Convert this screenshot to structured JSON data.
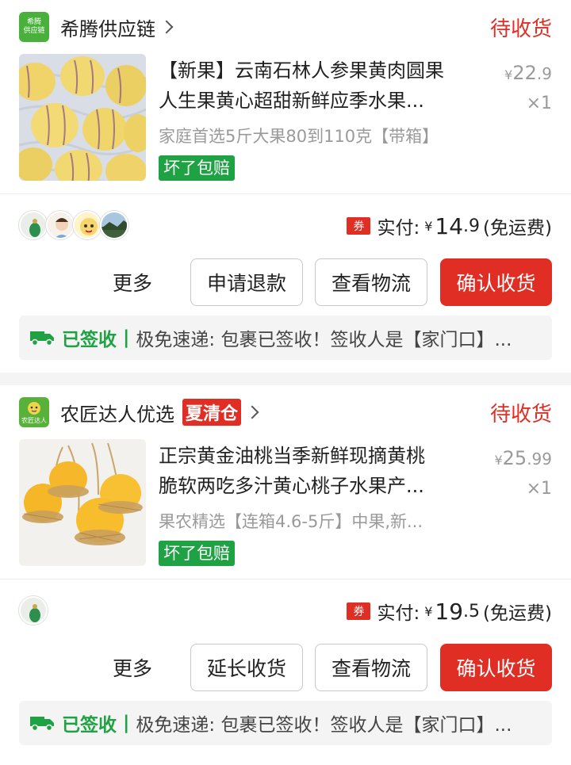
{
  "orders": [
    {
      "shop_logo_lines": [
        "希腾",
        "供应链"
      ],
      "shop_name": "希腾供应链",
      "status": "待收货",
      "title_line1": "【新果】云南石林人参果黄肉圆果",
      "title_line2": "人生果黄心超甜新鲜应季水果...",
      "spec": "家庭首选5斤大果80到110克【带箱】",
      "guarantee": "坏了包赔",
      "price_yen": "¥",
      "price_main": "22",
      "price_dec": ".9",
      "qty": "×1",
      "coupon": "券",
      "paid_label": "实付:",
      "paid_yen": "¥",
      "paid_main": "14",
      "paid_dec": ".9",
      "paid_note": "(免运费)",
      "more_label": "更多",
      "btn1": "申请退款",
      "btn2": "查看物流",
      "btn3": "确认收货",
      "logistics_status": "已签收",
      "logistics_sep": "|",
      "logistics_text": "极免速递: 包裹已签收！签收人是【家门口】..."
    },
    {
      "shop_logo_lines": [
        "农匠达人"
      ],
      "shop_name": "农匠达人优选",
      "shop_tag": "夏清仓",
      "status": "待收货",
      "title_line1": "正宗黄金油桃当季新鲜现摘黄桃",
      "title_line2": "脆软两吃多汁黄心桃子水果产...",
      "spec": "果农精选【连箱4.6-5斤】中果,新...",
      "guarantee": "坏了包赔",
      "price_yen": "¥",
      "price_main": "25",
      "price_dec": ".99",
      "qty": "×1",
      "coupon": "券",
      "paid_label": "实付:",
      "paid_yen": "¥",
      "paid_main": "19",
      "paid_dec": ".5",
      "paid_note": "(免运费)",
      "more_label": "更多",
      "btn1": "延长收货",
      "btn2": "查看物流",
      "btn3": "确认收货",
      "logistics_status": "已签收",
      "logistics_sep": "|",
      "logistics_text": "极免速递: 包裹已签收！签收人是【家门口】..."
    }
  ],
  "colors": {
    "accent_red": "#e02e24",
    "green": "#1fa244",
    "grey_text": "#9a9a9a"
  }
}
